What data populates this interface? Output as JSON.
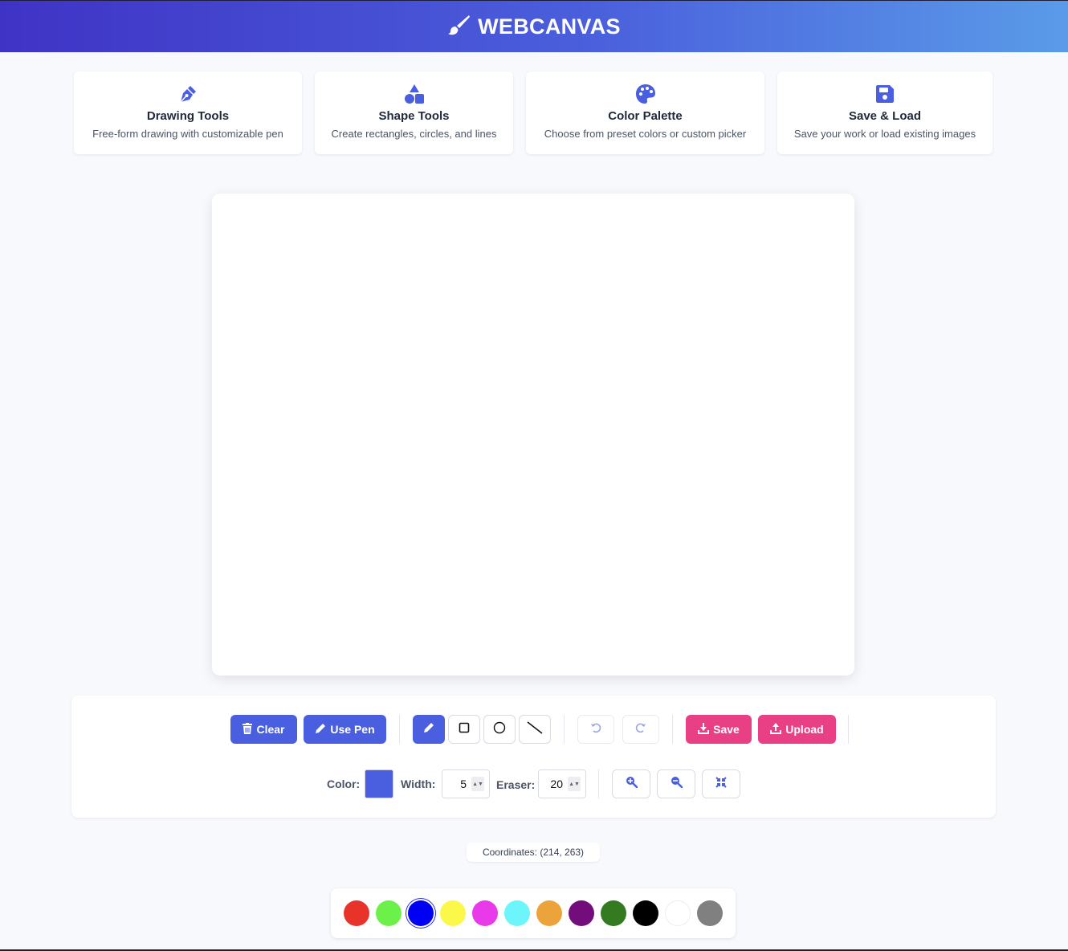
{
  "header": {
    "title": "WEBCANVAS",
    "icon": "paintbrush-icon"
  },
  "features": [
    {
      "title": "Drawing Tools",
      "desc": "Free-form drawing with customizable pen",
      "icon": "pen-nib-icon"
    },
    {
      "title": "Shape Tools",
      "desc": "Create rectangles, circles, and lines",
      "icon": "shapes-icon"
    },
    {
      "title": "Color Palette",
      "desc": "Choose from preset colors or custom picker",
      "icon": "palette-icon"
    },
    {
      "title": "Save & Load",
      "desc": "Save your work or load existing images",
      "icon": "floppy-disk-icon"
    }
  ],
  "toolbar": {
    "clear_label": "Clear",
    "use_pen_label": "Use Pen",
    "save_label": "Save",
    "upload_label": "Upload",
    "color_label": "Color:",
    "width_label": "Width:",
    "width_value": "5",
    "eraser_label": "Eraser:",
    "eraser_value": "20",
    "current_color": "#4a5fe0",
    "active_tool": "pen"
  },
  "status": {
    "coords_label": "Coordinates:",
    "coords_value": "(214, 263)"
  },
  "palette": {
    "colors": [
      "#e8332a",
      "#6cf04a",
      "#0000f5",
      "#fbf84a",
      "#e83ae8",
      "#6cf5fb",
      "#eca33a",
      "#730d7c",
      "#347a20",
      "#000000",
      "#ffffff",
      "#808080"
    ],
    "selected_index": 2
  },
  "theme": {
    "accent": "#4a5fe0",
    "pink": "#e93f85"
  }
}
